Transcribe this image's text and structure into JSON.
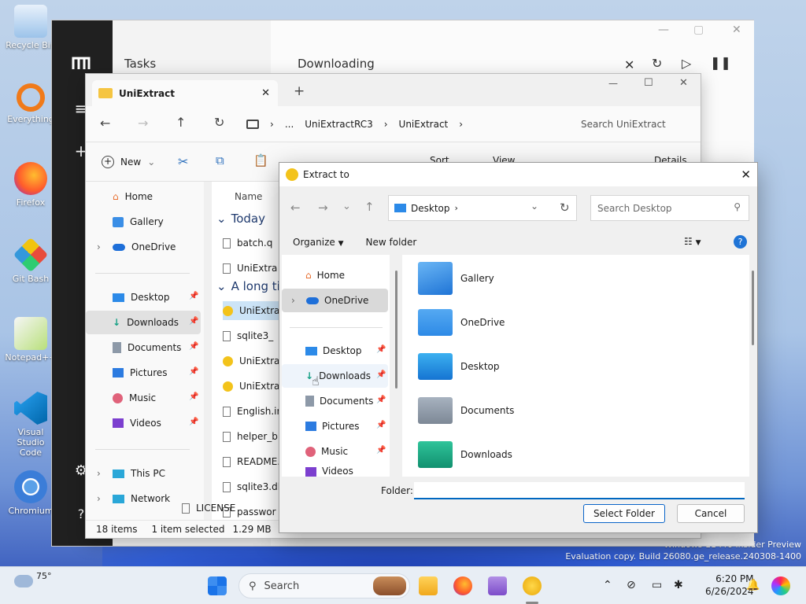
{
  "desktop": {
    "icons": [
      "Recycle Bin",
      "Everything",
      "Firefox",
      "Git Bash",
      "Notepad++",
      "Visual Studio Code",
      "Chromium"
    ],
    "watermark_line1": "Windows 11 Pro Insider Preview",
    "watermark_line2": "Evaluation copy. Build 26080.ge_release.240308-1400"
  },
  "tasks": {
    "title": "Tasks",
    "subtitle": "Downloading"
  },
  "explorer": {
    "tab_title": "UniExtract",
    "new_tab": "+",
    "breadcrumb": [
      "...",
      "UniExtractRC3",
      "UniExtract"
    ],
    "search_placeholder": "Search UniExtract",
    "new_label": "New",
    "sort_label": "Sort",
    "view_label": "View",
    "details_label": "Details",
    "nav": {
      "home": "Home",
      "gallery": "Gallery",
      "onedrive": "OneDrive",
      "desktop": "Desktop",
      "downloads": "Downloads",
      "documents": "Documents",
      "pictures": "Pictures",
      "music": "Music",
      "videos": "Videos",
      "thispc": "This PC",
      "network": "Network"
    },
    "col_name": "Name",
    "group_today": "Today",
    "group_long": "A long ti",
    "files": [
      "batch.q",
      "UniExtra",
      "UniExtra",
      "sqlite3_",
      "UniExtra",
      "UniExtrac",
      "English.ir",
      "helper_bi",
      "README.",
      "sqlite3.dl",
      "passwor",
      "LICENSE"
    ],
    "status_items": "18 items",
    "status_selected": "1 item selected",
    "status_size": "1.29 MB"
  },
  "dialog": {
    "title": "Extract to",
    "address": "Desktop",
    "search_placeholder": "Search Desktop",
    "organize": "Organize",
    "new_folder": "New folder",
    "nav": {
      "home": "Home",
      "onedrive": "OneDrive",
      "desktop": "Desktop",
      "downloads": "Downloads",
      "documents": "Documents",
      "pictures": "Pictures",
      "music": "Music",
      "videos": "Videos"
    },
    "items": [
      "Gallery",
      "OneDrive",
      "Desktop",
      "Documents",
      "Downloads"
    ],
    "folder_label": "Folder:",
    "folder_value": "",
    "select_button": "Select Folder",
    "cancel_button": "Cancel"
  },
  "taskbar": {
    "temperature": "75°",
    "search_label": "Search",
    "time": "6:20 PM",
    "date": "6/26/2024"
  },
  "colors": {
    "accent": "#0067c0",
    "folder_blue": "#3a8ee6",
    "folder_teal": "#16a085",
    "selection": "#cce4f7"
  }
}
